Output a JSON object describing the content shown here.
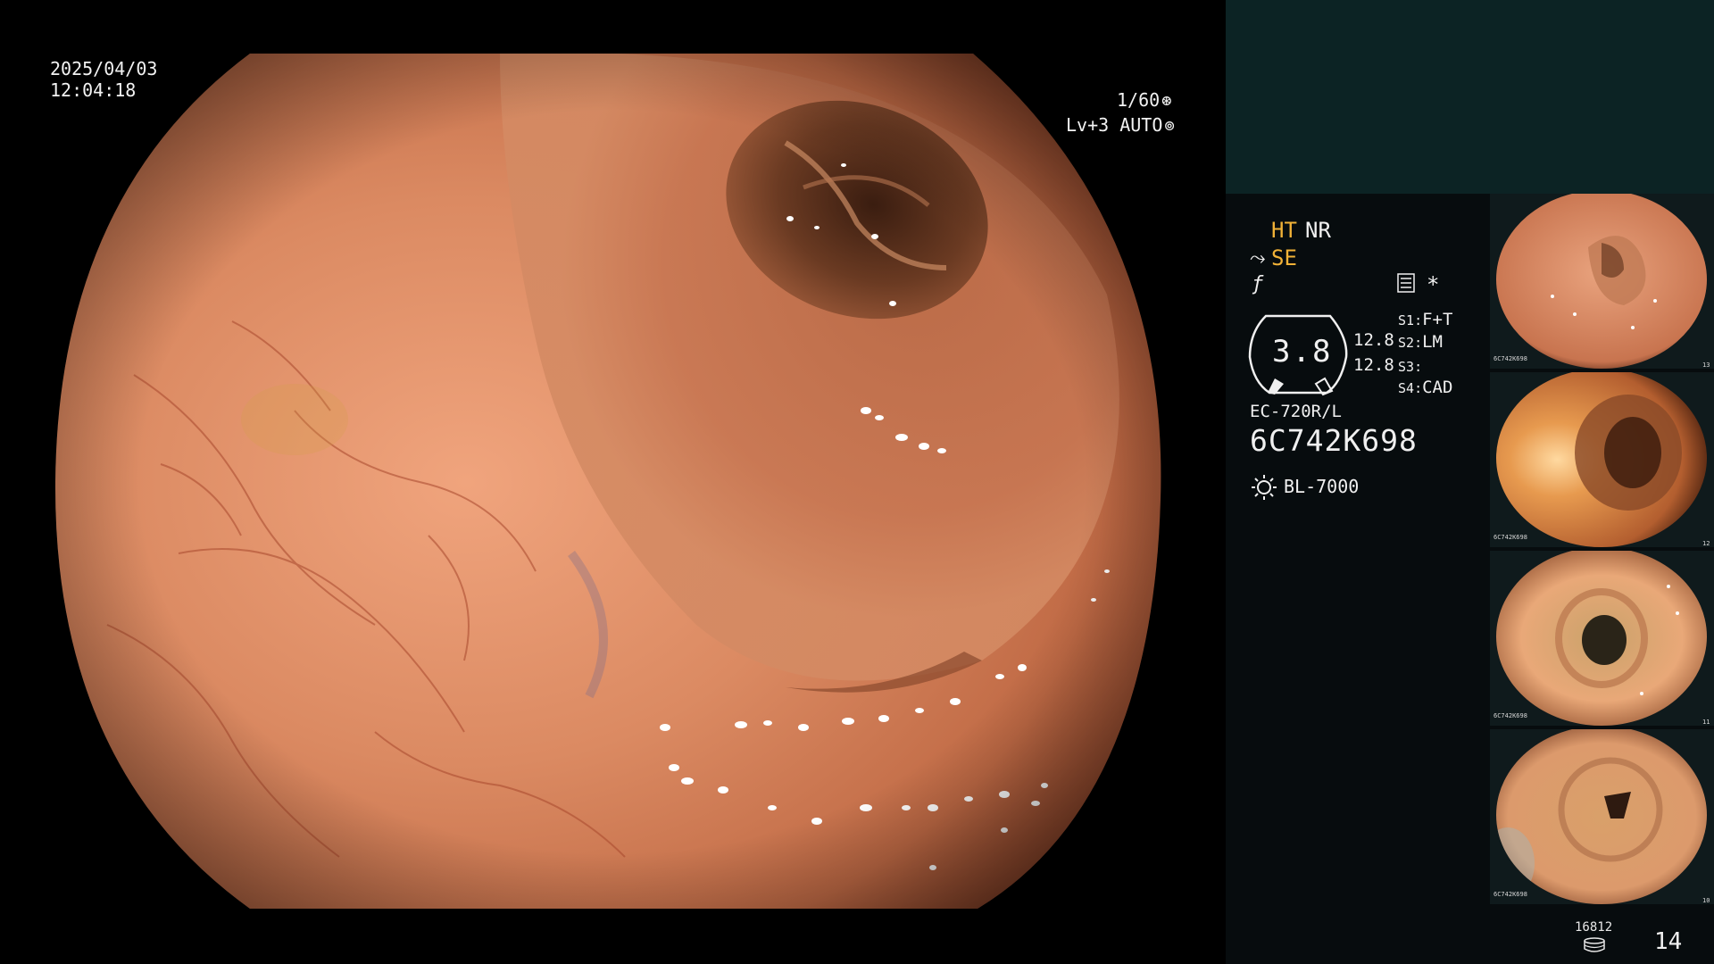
{
  "osd": {
    "date": "2025/04/03",
    "time": "12:04:18",
    "shutter": "1/60",
    "shutter_icon": "aperture-icon",
    "level": "Lv+3 AUTO",
    "auto_icon": "auto-iris-icon"
  },
  "status": {
    "mode_ht": "HT",
    "mode_nr": "NR",
    "mode_se": "SE",
    "se_icon": "scope-tip-icon",
    "f_icon": "lightning-icon",
    "menu_icon": "menu-list-icon",
    "asterisk": "*",
    "zoom_value": "3.8",
    "value_a": "12.8",
    "value_b": "12.8",
    "switches": [
      {
        "key": "S1",
        "value": "F+T"
      },
      {
        "key": "S2",
        "value": "LM"
      },
      {
        "key": "S3",
        "value": ""
      },
      {
        "key": "S4",
        "value": "CAD"
      }
    ],
    "scope_model": "EC-720R/L",
    "scope_serial": "6C742K698",
    "light_icon": "light-bulb-icon",
    "light_source": "BL-7000"
  },
  "thumbnails": [
    {
      "label": "6C742K698",
      "index": "13"
    },
    {
      "label": "6C742K698",
      "index": "12"
    },
    {
      "label": "6C742K698",
      "index": "11"
    },
    {
      "label": "6C742K698",
      "index": "10"
    }
  ],
  "storage": {
    "count": "16812",
    "icon": "storage-disk-icon",
    "image_count": "14"
  },
  "colors": {
    "panel_top": "#0c2324",
    "panel": "#070c0e",
    "accent": "#f1b237",
    "mucosa": "#d98a63"
  }
}
